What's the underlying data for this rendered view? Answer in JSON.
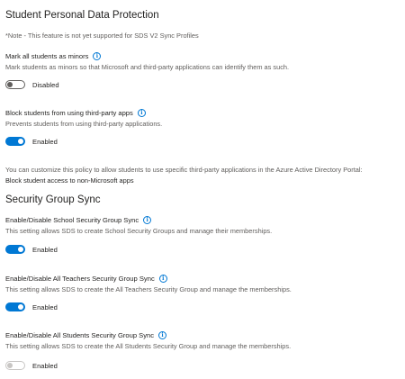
{
  "student_data_protection": {
    "heading": "Student Personal Data Protection",
    "note": "*Note - This feature is not yet supported for SDS V2 Sync Profiles",
    "mark_minors": {
      "label": "Mark all students as minors",
      "description": "Mark students as minors so that Microsoft and third-party applications can identify them as such.",
      "state": "off",
      "toggle_label": "Disabled"
    },
    "block_apps": {
      "label": "Block students from using third-party apps",
      "description": "Prevents students from using third-party applications.",
      "state": "on",
      "toggle_label": "Enabled"
    },
    "customize_text": "You can customize this policy to allow students to use specific third-party applications in the Azure Active Directory Portal:",
    "link_text": "Block student access to non-Microsoft apps"
  },
  "security_group_sync": {
    "heading": "Security Group Sync",
    "school": {
      "label": "Enable/Disable School Security Group Sync",
      "description": "This setting allows SDS to create School Security Groups and manage their memberships.",
      "state": "on",
      "toggle_label": "Enabled"
    },
    "teachers": {
      "label": "Enable/Disable All Teachers Security Group Sync",
      "description": "This setting allows SDS to create the All Teachers Security Group and manage the memberships.",
      "state": "on",
      "toggle_label": "Enabled"
    },
    "students": {
      "label": "Enable/Disable All Students Security Group Sync",
      "description": "This setting allows SDS to create the All Students Security Group and manage the memberships.",
      "state": "disabled",
      "toggle_label": "Enabled"
    }
  },
  "colors": {
    "accent": "#0078d4",
    "text": "#201f1e",
    "secondary": "#605e5c",
    "disabled": "#c8c6c4"
  },
  "icons": {
    "info": "info-circle-icon"
  }
}
